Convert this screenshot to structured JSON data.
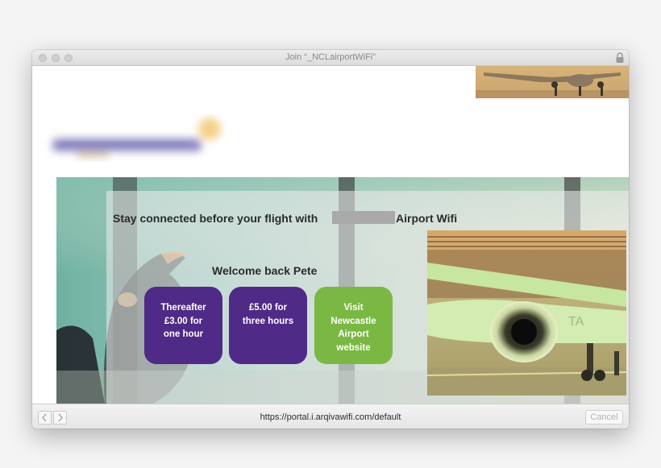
{
  "window": {
    "title": "Join “_NCLairportWiFi”"
  },
  "portal": {
    "headline_prefix": "Stay connected before your flight with",
    "headline_suffix": "Airport Wifi",
    "welcome": "Welcome back Pete",
    "tiles": [
      {
        "line1": "Thereafter",
        "line2": "£3.00 for",
        "line3": "one hour",
        "color": "#4f2a86"
      },
      {
        "line1": "£5.00 for",
        "line2": "three hours",
        "line3": "",
        "color": "#4f2a86"
      },
      {
        "line1": "Visit",
        "line2": "Newcastle",
        "line3": "Airport",
        "line4": "website",
        "color": "#7ab843"
      }
    ]
  },
  "toolbar": {
    "back_icon": "chevron-left-icon",
    "forward_icon": "chevron-right-icon",
    "url": "https://portal.i.arqivawifi.com/default",
    "cancel_label": "Cancel"
  },
  "colors": {
    "accent_purple": "#4f2a86",
    "accent_green": "#7ab843"
  }
}
